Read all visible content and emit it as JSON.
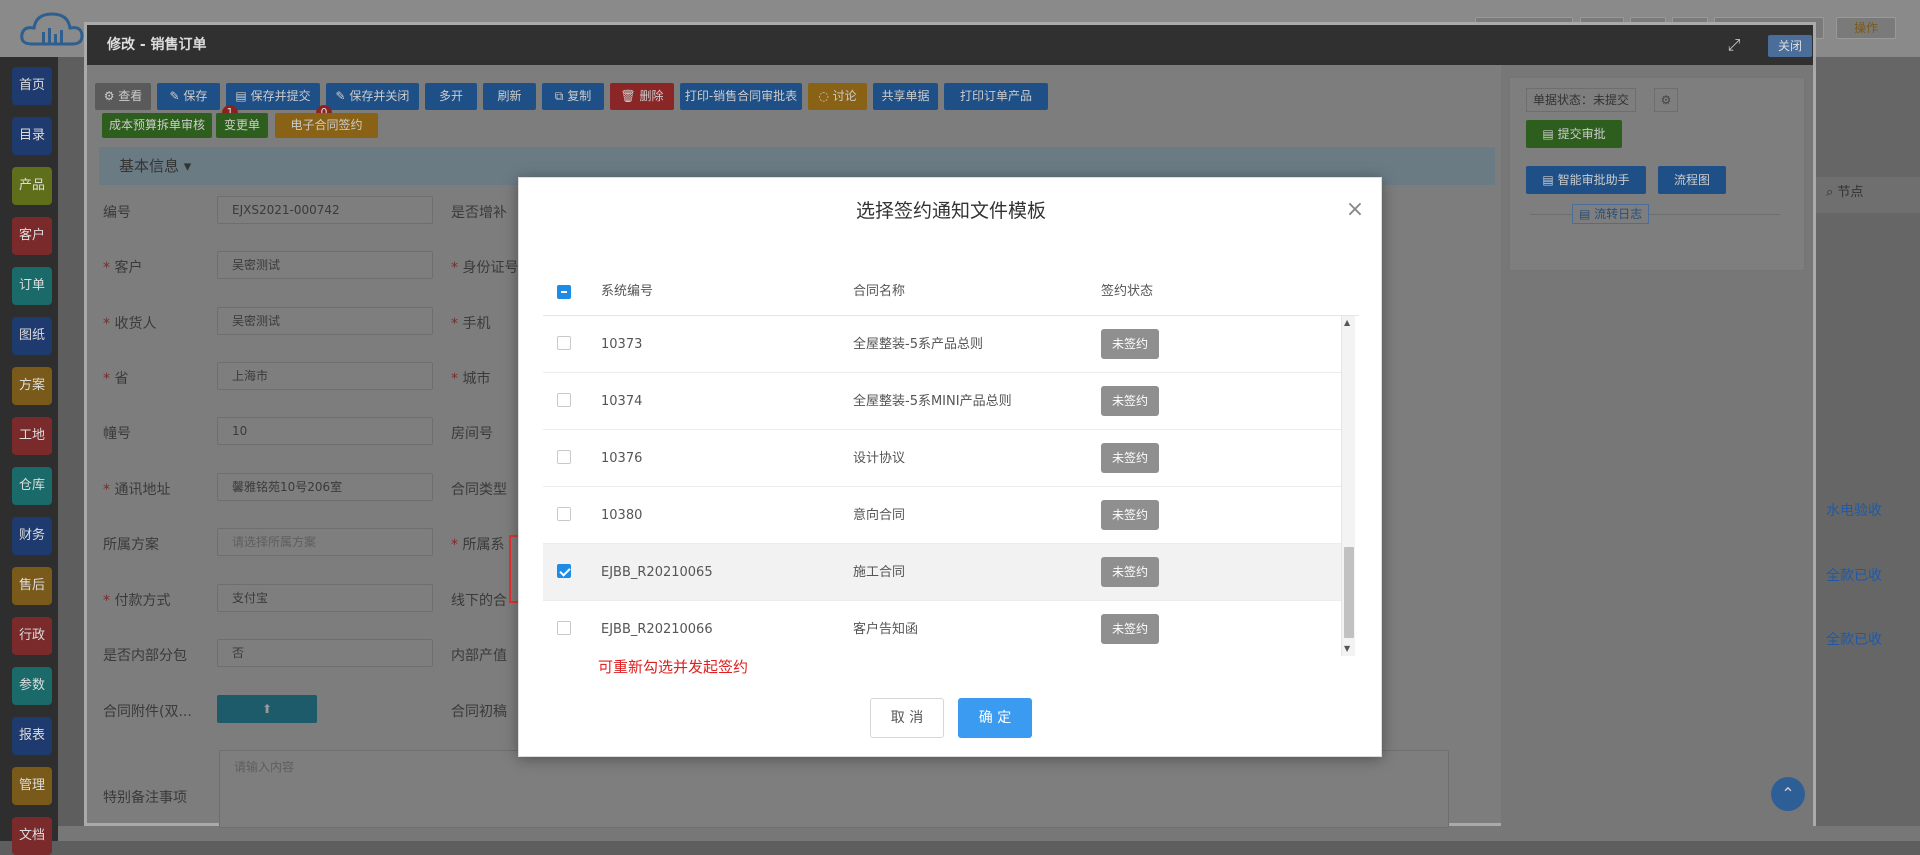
{
  "window": {
    "title": "修改 - 销售订单",
    "close_label": "关闭"
  },
  "sidebar": {
    "items": [
      {
        "label": "首页",
        "color": "#1e3a6e"
      },
      {
        "label": "目录",
        "color": "#1e3a6e"
      },
      {
        "label": "产品",
        "color": "#5e6e1a"
      },
      {
        "label": "客户",
        "color": "#7a2a2a"
      },
      {
        "label": "订单",
        "color": "#1a6a6a"
      },
      {
        "label": "图纸",
        "color": "#1e3a6e"
      },
      {
        "label": "方案",
        "color": "#7a5a1a"
      },
      {
        "label": "工地",
        "color": "#7a2a2a"
      },
      {
        "label": "仓库",
        "color": "#1a6a6a"
      },
      {
        "label": "财务",
        "color": "#1e3a6e"
      },
      {
        "label": "售后",
        "color": "#7a5a1a"
      },
      {
        "label": "行政",
        "color": "#7a2a2a"
      },
      {
        "label": "参数",
        "color": "#1a6a6a"
      },
      {
        "label": "报表",
        "color": "#1e3a6e"
      },
      {
        "label": "管理",
        "color": "#7a5a1a"
      },
      {
        "label": "文档",
        "color": "#7a2a2a"
      }
    ]
  },
  "background_right": {
    "items": [
      "水电验收",
      "全款已收",
      "全款已收"
    ],
    "top_action": "操作",
    "node_label": "节点"
  },
  "toolbar": {
    "row1": [
      {
        "label": "查看",
        "icon": "gear-icon",
        "color": "#5a5a5a"
      },
      {
        "label": "保存",
        "icon": "edit-icon",
        "color": "#1e4f86"
      },
      {
        "label": "保存并提交",
        "icon": "doc-icon",
        "color": "#1e4f86"
      },
      {
        "label": "保存并关闭",
        "icon": "edit-icon",
        "color": "#1e4f86"
      },
      {
        "label": "多开",
        "icon": "",
        "color": "#1e4f86"
      },
      {
        "label": "刷新",
        "icon": "",
        "color": "#1e4f86"
      },
      {
        "label": "复制",
        "icon": "copy-icon",
        "color": "#1e4f86"
      },
      {
        "label": "删除",
        "icon": "trash-icon",
        "color": "#8a2626"
      },
      {
        "label": "打印-销售合同审批表",
        "icon": "",
        "color": "#1e4f86"
      },
      {
        "label": "讨论",
        "icon": "chat-icon",
        "color": "#8a6216"
      },
      {
        "label": "共享单据",
        "icon": "",
        "color": "#1e4f86"
      },
      {
        "label": "打印订单产品",
        "icon": "",
        "color": "#1e4f86"
      }
    ],
    "row2": [
      {
        "label": "成本预算拆单审核",
        "badge": "1",
        "color": "#2e5e1e"
      },
      {
        "label": "变更单",
        "badge": "0",
        "color": "#2e5e1e"
      },
      {
        "label": "电子合同签约",
        "badge": "",
        "color": "#8a6216"
      }
    ]
  },
  "section": {
    "title": "基本信息"
  },
  "form": {
    "left": [
      {
        "label": "编号",
        "required": false,
        "value": "EJXS2021-000742",
        "placeholder": false
      },
      {
        "label": "客户",
        "required": true,
        "value": "吴密测试",
        "placeholder": false
      },
      {
        "label": "收货人",
        "required": true,
        "value": "吴密测试",
        "placeholder": false
      },
      {
        "label": "省",
        "required": true,
        "value": "上海市",
        "placeholder": false
      },
      {
        "label": "幢号",
        "required": false,
        "value": "10",
        "placeholder": false
      },
      {
        "label": "通讯地址",
        "required": true,
        "value": "馨雅铭苑10号206室",
        "placeholder": false
      },
      {
        "label": "所属方案",
        "required": false,
        "value": "请选择所属方案",
        "placeholder": true
      },
      {
        "label": "付款方式",
        "required": true,
        "value": "支付宝",
        "placeholder": false
      },
      {
        "label": "是否内部分包",
        "required": false,
        "value": "否",
        "placeholder": false
      },
      {
        "label": "合同附件(双...",
        "required": false,
        "value": "",
        "placeholder": false
      }
    ],
    "middle": [
      {
        "label": "是否增补",
        "required": false
      },
      {
        "label": "身份证号",
        "required": true
      },
      {
        "label": "手机",
        "required": true
      },
      {
        "label": "城市",
        "required": true
      },
      {
        "label": "房间号",
        "required": false
      },
      {
        "label": "合同类型",
        "required": false
      },
      {
        "label": "所属系",
        "required": true
      },
      {
        "label": "线下的合",
        "required": false
      },
      {
        "label": "内部产值",
        "required": false
      },
      {
        "label": "合同初稿",
        "required": false
      }
    ],
    "remark_label": "特别备注事项",
    "remark_placeholder": "请输入内容"
  },
  "right_panel": {
    "status_text": "单据状态：未提交",
    "submit_label": "提交审批",
    "assistant_label": "智能审批助手",
    "flow_label": "流程图",
    "log_label": "流转日志"
  },
  "modal": {
    "title": "选择签约通知文件模板",
    "columns": [
      "系统编号",
      "合同名称",
      "签约状态"
    ],
    "header_checkbox_state": "partial",
    "rows": [
      {
        "id": "10373",
        "name": "全屋整装-5系产品总则",
        "status": "未签约",
        "checked": false
      },
      {
        "id": "10374",
        "name": "全屋整装-5系MINI产品总则",
        "status": "未签约",
        "checked": false
      },
      {
        "id": "10376",
        "name": "设计协议",
        "status": "未签约",
        "checked": false
      },
      {
        "id": "10380",
        "name": "意向合同",
        "status": "未签约",
        "checked": false
      },
      {
        "id": "EJBB_R20210065",
        "name": "施工合同",
        "status": "未签约",
        "checked": true
      },
      {
        "id": "EJBB_R20210066",
        "name": "客户告知函",
        "status": "未签约",
        "checked": false
      }
    ],
    "note": "可重新勾选并发起签约",
    "cancel_label": "取 消",
    "ok_label": "确 定"
  },
  "colors": {
    "primary": "#3a9bf0",
    "highlight_box": "#e83030",
    "note_text": "#e02020",
    "status_badge": "#8f8f8f"
  }
}
